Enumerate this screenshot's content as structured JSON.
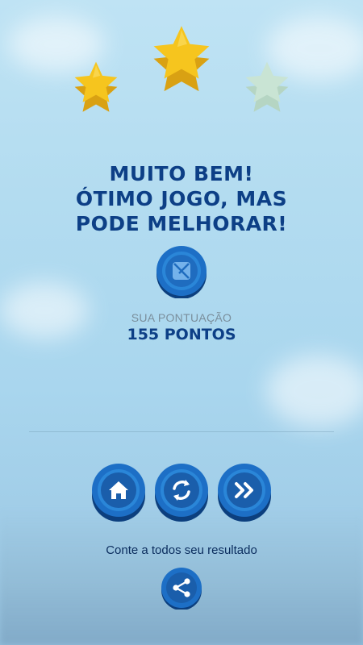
{
  "result": {
    "stars_earned": 2,
    "stars_total": 3,
    "headline_lines": [
      "MUITO BEM!",
      "ÓTIMO JOGO, MAS",
      "PODE MELHORAR!"
    ],
    "score_label": "SUA PONTUAÇÃO",
    "score_value": "155 PONTOS"
  },
  "actions": {
    "home_icon": "home-icon",
    "replay_icon": "replay-icon",
    "next_icon": "fast-forward-icon"
  },
  "share": {
    "text": "Conte a todos seu resultado",
    "icon": "share-icon"
  },
  "colors": {
    "brand_blue": "#0d3f86",
    "button_blue": "#1d6fc6",
    "star_gold": "#f6c51e",
    "star_faded": "#c9e4d4",
    "label_gray": "#7a8e9c"
  }
}
